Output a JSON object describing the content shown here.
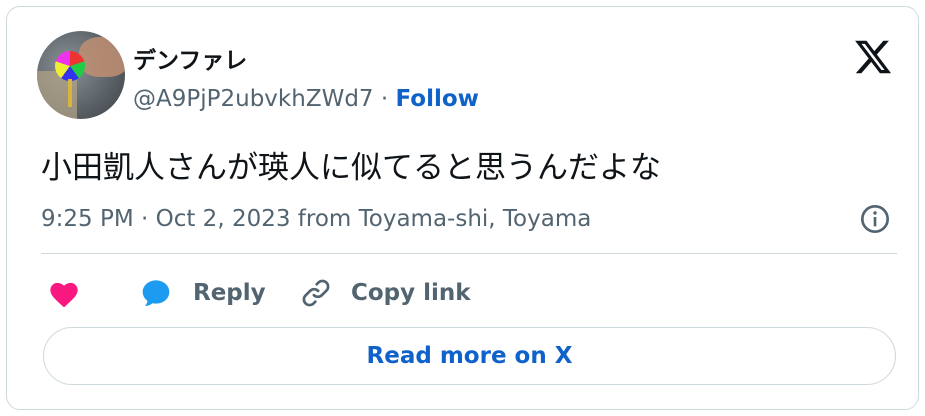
{
  "user": {
    "display_name": "デンファレ",
    "handle": "@A9PjP2ubvkhZWd7",
    "separator": "·",
    "follow_label": "Follow"
  },
  "tweet": {
    "text": "小田凱人さんが瑛人に似てると思うんだよな",
    "time": "9:25 PM · Oct 2, 2023 from Toyama-shi, Toyama"
  },
  "actions": {
    "reply_label": "Reply",
    "copy_label": "Copy link"
  },
  "read_more_label": "Read more on X",
  "colors": {
    "accent": "#0f62c9",
    "like": "#f91880",
    "reply_icon": "#1d9bf0",
    "secondary_text": "#536471",
    "border": "#cfd9de"
  },
  "icons": [
    "x-logo-icon",
    "info-icon",
    "heart-icon",
    "speech-bubble-icon",
    "link-icon"
  ]
}
